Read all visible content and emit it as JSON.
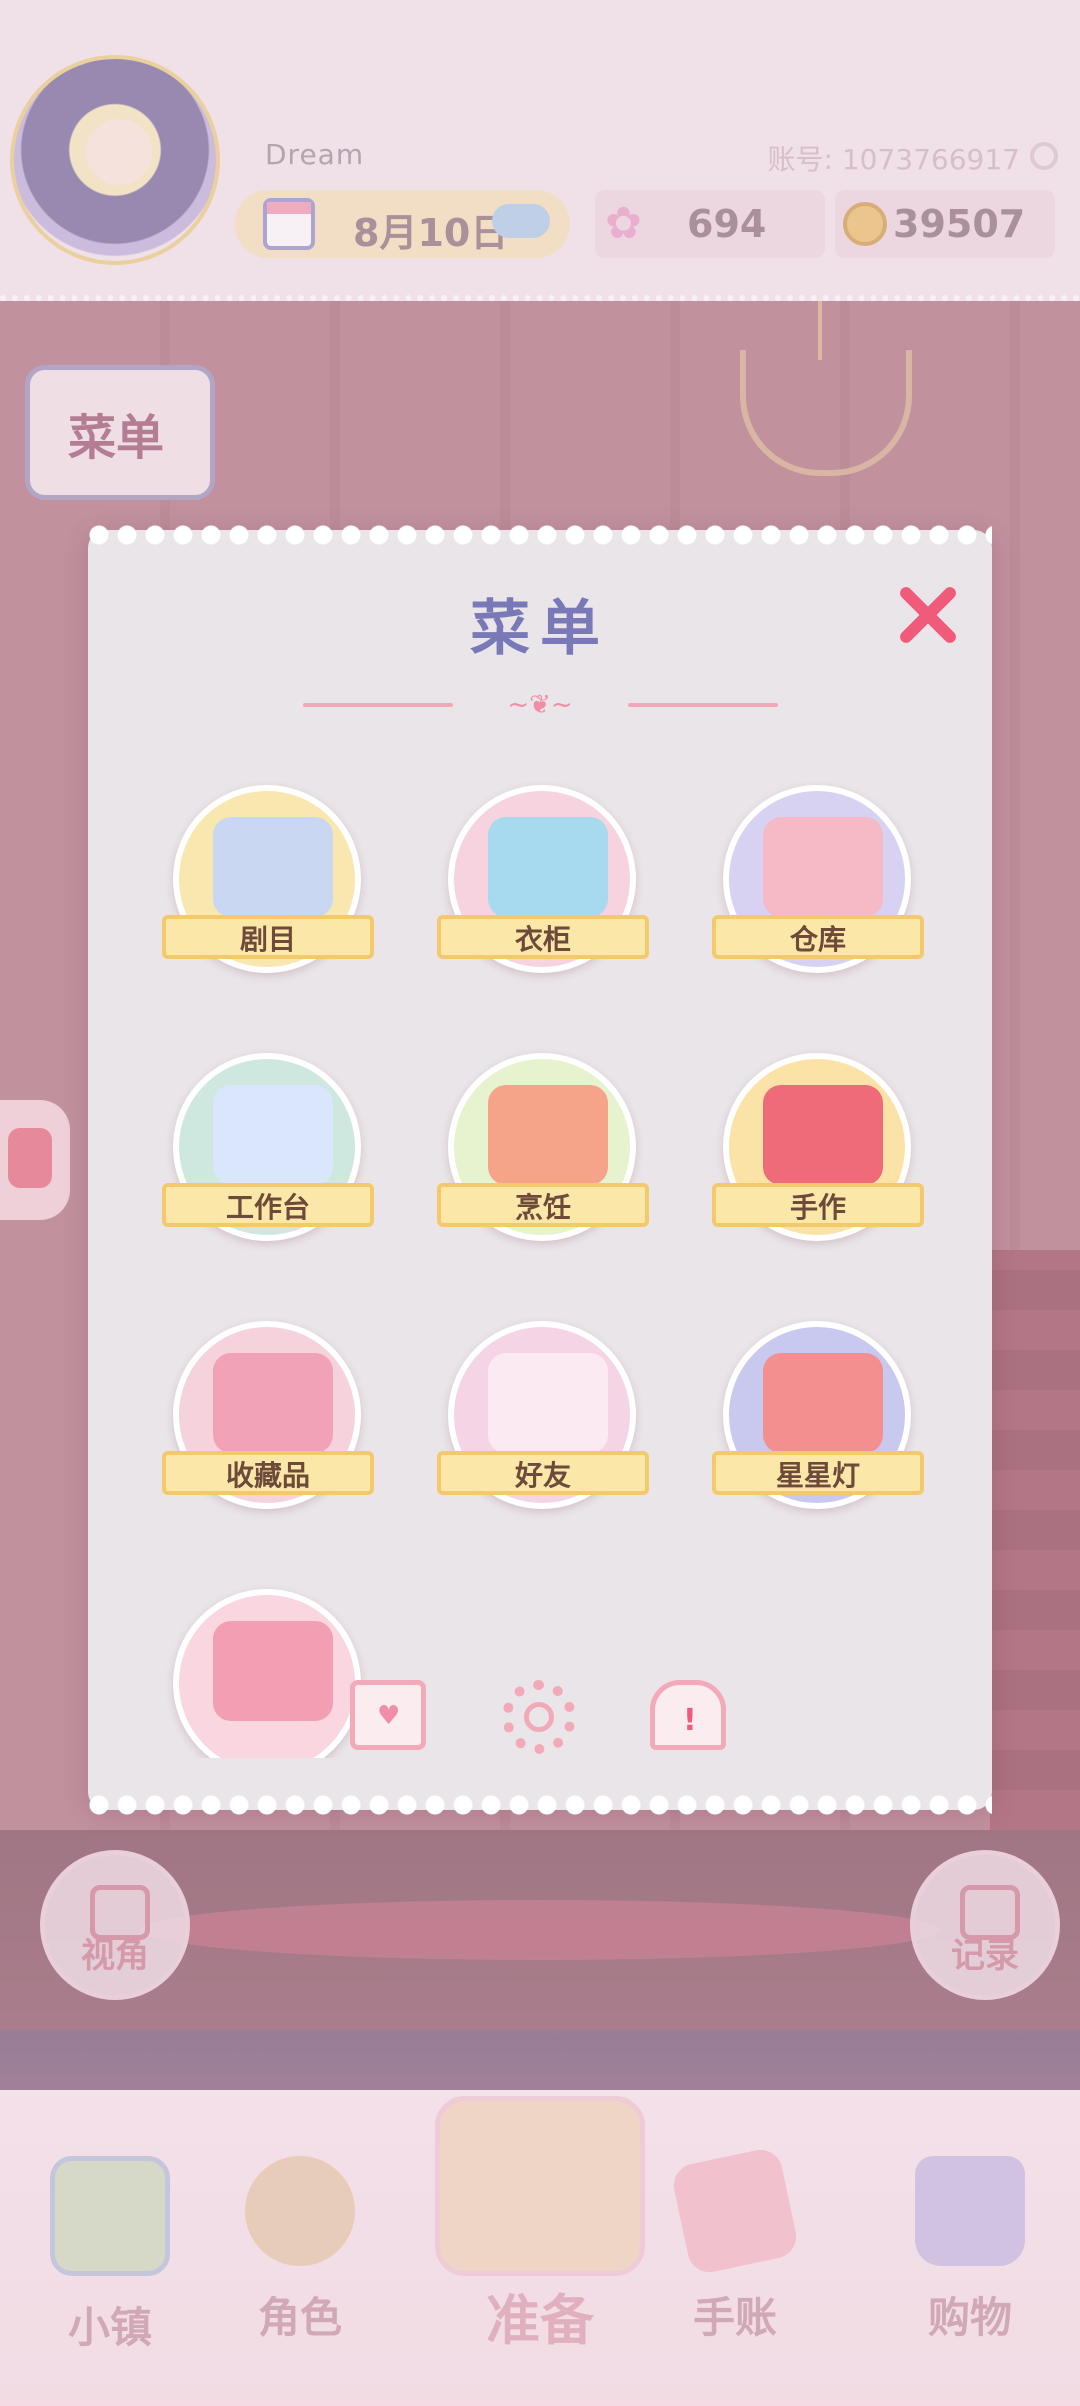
{
  "top_bar": {
    "player_name": "Dream",
    "account_id": "账号: 1073766917",
    "date": "8月10日",
    "flower_count": "694",
    "coin_count": "39507",
    "icons": [
      "avatar",
      "calendar-icon",
      "cloud-icon",
      "flower-icon",
      "coin-icon",
      "copy-icon"
    ]
  },
  "scene": {
    "menu_button": "菜单",
    "view_button": "视角",
    "record_button": "记录"
  },
  "bottom_nav": {
    "items": [
      {
        "label": "小镇",
        "icon": "map-icon"
      },
      {
        "label": "角色",
        "icon": "character-icon"
      },
      {
        "label": "准备",
        "icon": "basket-icon"
      },
      {
        "label": "手账",
        "icon": "notebook-icon"
      },
      {
        "label": "购物",
        "icon": "shopping-bag-icon"
      }
    ]
  },
  "menu_modal": {
    "title": "菜单",
    "items": [
      {
        "label": "剧目",
        "icon": "script-book-icon",
        "bg": "#f9e7b0",
        "art": "#c9d7f2"
      },
      {
        "label": "衣柜",
        "icon": "wardrobe-icon",
        "bg": "#f7d3e0",
        "art": "#a7d9ef"
      },
      {
        "label": "仓库",
        "icon": "warehouse-box-icon",
        "bg": "#d8d2f2",
        "art": "#f6b9c6"
      },
      {
        "label": "工作台",
        "icon": "blueprint-icon",
        "bg": "#cfe8df",
        "art": "#d9e6fb"
      },
      {
        "label": "烹饪",
        "icon": "cooking-pot-icon",
        "bg": "#e7f2cf",
        "art": "#f5a48a"
      },
      {
        "label": "手作",
        "icon": "scissors-icon",
        "bg": "#fbe3a8",
        "art": "#ef6b7a"
      },
      {
        "label": "收藏品",
        "icon": "carousel-icon",
        "bg": "#f6d2dc",
        "art": "#f2a2b6"
      },
      {
        "label": "好友",
        "icon": "friends-birds-icon",
        "bg": "#f5d4e6",
        "art": "#fbeaf1"
      },
      {
        "label": "星星灯",
        "icon": "star-lamp-icon",
        "bg": "#c9c8ee",
        "art": "#f38f8e"
      },
      {
        "label": "",
        "icon": "sofa-icon",
        "bg": "#f9d6e0",
        "art": "#f29fb4"
      }
    ],
    "footer_icons": [
      "mail-icon",
      "settings-icon",
      "notice-icon"
    ]
  }
}
